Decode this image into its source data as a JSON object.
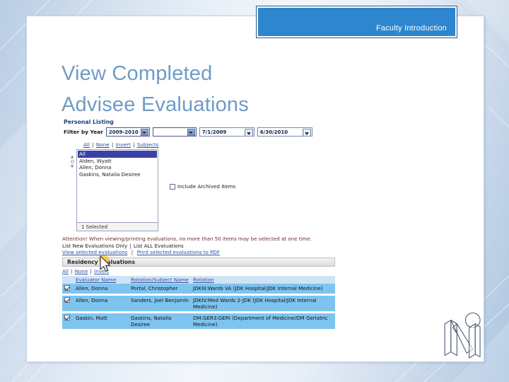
{
  "banner": {
    "title": "Faculty Introduction"
  },
  "slide": {
    "title_line1": "View Completed",
    "title_line2": "Advisee Evaluations"
  },
  "app": {
    "personal_listing": {
      "section_title": "Personal Listing",
      "filter_label": "Filter by Year",
      "year_value": "2009-2010",
      "secondary_value": "",
      "start_date": "7/1/2009",
      "end_date": "6/30/2010"
    },
    "selection_links": {
      "all": "All",
      "none": "None",
      "invert": "Invert",
      "subjects": "Subjects"
    },
    "listbox": {
      "options": [
        "All",
        "Alden, Wyatt",
        "Allen, Donna",
        "Gaskins, Natalia Desiree"
      ],
      "selected": "All",
      "footer": "1 Selected"
    },
    "archived_checkbox": {
      "label": "Include Archived Items",
      "checked": false
    },
    "notice": "Attention! When viewing/printing evaluations, no more than 50 items may be selected at one time.",
    "list_modes": {
      "new_only": "List New Evaluations Only",
      "all": "List ALL Evaluations"
    },
    "actions": {
      "view": "View selected evaluations",
      "print": "Print selected evaluations to PDF"
    },
    "grid": {
      "header": "Residency Evaluations",
      "links": {
        "all": "All",
        "none": "None",
        "invert": "Invert"
      },
      "columns": [
        "Evaluator Name",
        "Rotation/Subject Name",
        "Rotation"
      ],
      "rows": [
        {
          "checked": true,
          "evaluator": "Allen, Donna",
          "subject": "Portal, Christopher",
          "rotation": "JDKIII:Wards VA (JDK Hospital/JDK Internal Medicine)"
        },
        {
          "checked": true,
          "evaluator": "Allen, Donna",
          "subject": "Sanders, Joel Benjamin",
          "rotation": "JDKIV:Med Wards 2-JDK (JDK Hospital/JDK Internal Medicine)"
        },
        {
          "checked": true,
          "evaluator": "Gaskin, Matt",
          "subject": "Gaskins, Natalia Desiree",
          "rotation": "DM:GER3:GERI (Department of Medicine/DM Geriatric Medicine)"
        }
      ]
    }
  },
  "colors": {
    "banner_blue": "#2e86ce",
    "title_blue": "#6f9bc6",
    "link_blue": "#2d4fa0",
    "row_blue": "#7ec4ef",
    "header_blue": "#cfe3f5"
  }
}
